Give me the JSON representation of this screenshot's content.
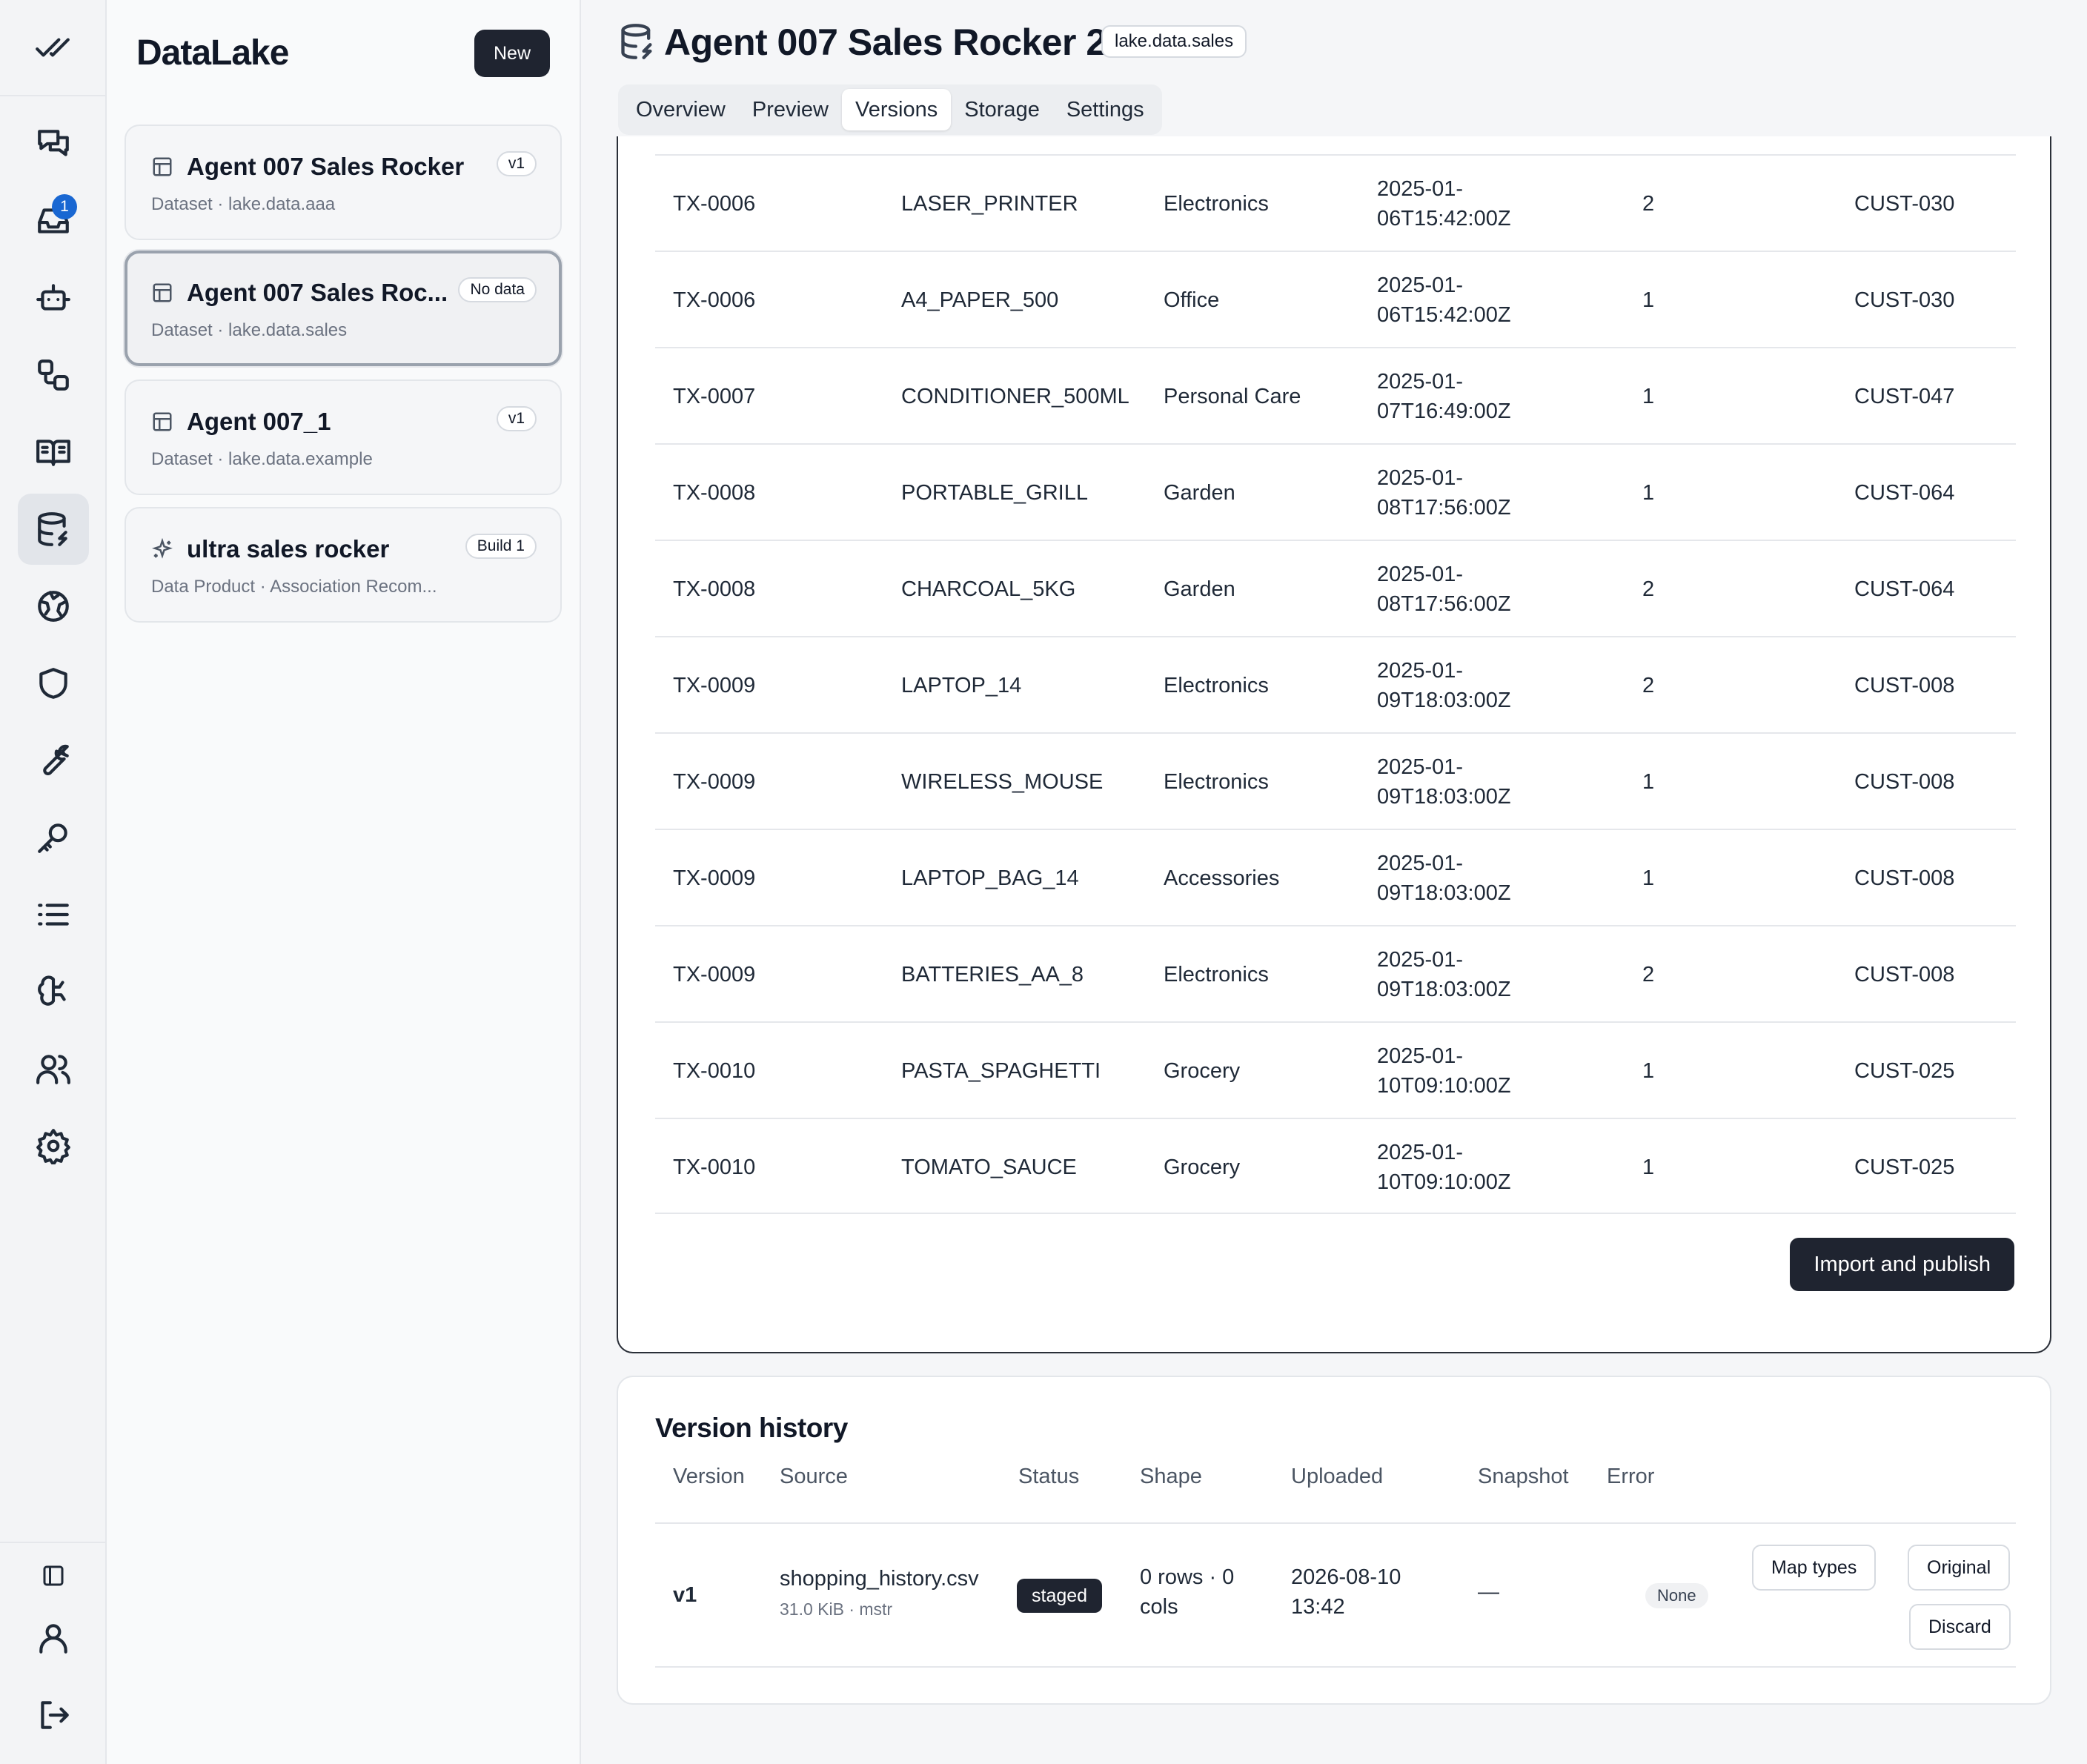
{
  "rail": {
    "top_icon": "double-check-icon",
    "items": [
      {
        "icon": "chat-icon"
      },
      {
        "icon": "inbox-icon",
        "badge": "1"
      },
      {
        "icon": "robot-icon"
      },
      {
        "icon": "workflow-icon"
      },
      {
        "icon": "book-icon"
      },
      {
        "icon": "database-icon",
        "active": true
      },
      {
        "icon": "globe-icon"
      },
      {
        "icon": "shield-icon"
      },
      {
        "icon": "wrench-icon"
      },
      {
        "icon": "key-icon"
      },
      {
        "icon": "list-icon"
      },
      {
        "icon": "brain-icon"
      },
      {
        "icon": "users-icon"
      },
      {
        "icon": "gear-icon"
      }
    ],
    "bottom": [
      {
        "icon": "sidebar-toggle-icon"
      },
      {
        "icon": "user-icon"
      },
      {
        "icon": "logout-icon"
      }
    ]
  },
  "panel": {
    "brand": "DataLake",
    "new_label": "New",
    "cards": [
      {
        "title": "Agent 007 Sales Rocker",
        "subtitle": "Dataset · lake.data.aaa",
        "badge": "v1",
        "icon": "table-icon"
      },
      {
        "title": "Agent 007 Sales Roc...",
        "subtitle": "Dataset · lake.data.sales",
        "badge": "No data",
        "icon": "table-icon",
        "selected": true
      },
      {
        "title": "Agent 007_1",
        "subtitle": "Dataset · lake.data.example",
        "badge": "v1",
        "icon": "table-icon"
      },
      {
        "title": "ultra sales rocker",
        "subtitle": "Data Product · Association Recom...",
        "badge": "Build 1",
        "icon": "sparkles-icon"
      }
    ]
  },
  "header": {
    "title": "Agent 007 Sales Rocker 2",
    "namespace": "lake.data.sales",
    "tabs": [
      "Overview",
      "Preview",
      "Versions",
      "Storage",
      "Settings"
    ],
    "active_tab": "Versions"
  },
  "preview": {
    "rows": [
      [
        "TX-0006",
        "LASER_PRINTER",
        "Electronics",
        "2025-01-06T15:42:00Z",
        "2",
        "CUST-030"
      ],
      [
        "TX-0006",
        "A4_PAPER_500",
        "Office",
        "2025-01-06T15:42:00Z",
        "1",
        "CUST-030"
      ],
      [
        "TX-0007",
        "CONDITIONER_500ML",
        "Personal Care",
        "2025-01-07T16:49:00Z",
        "1",
        "CUST-047"
      ],
      [
        "TX-0008",
        "PORTABLE_GRILL",
        "Garden",
        "2025-01-08T17:56:00Z",
        "1",
        "CUST-064"
      ],
      [
        "TX-0008",
        "CHARCOAL_5KG",
        "Garden",
        "2025-01-08T17:56:00Z",
        "2",
        "CUST-064"
      ],
      [
        "TX-0009",
        "LAPTOP_14",
        "Electronics",
        "2025-01-09T18:03:00Z",
        "2",
        "CUST-008"
      ],
      [
        "TX-0009",
        "WIRELESS_MOUSE",
        "Electronics",
        "2025-01-09T18:03:00Z",
        "1",
        "CUST-008"
      ],
      [
        "TX-0009",
        "LAPTOP_BAG_14",
        "Accessories",
        "2025-01-09T18:03:00Z",
        "1",
        "CUST-008"
      ],
      [
        "TX-0009",
        "BATTERIES_AA_8",
        "Electronics",
        "2025-01-09T18:03:00Z",
        "2",
        "CUST-008"
      ],
      [
        "TX-0010",
        "PASTA_SPAGHETTI",
        "Grocery",
        "2025-01-10T09:10:00Z",
        "1",
        "CUST-025"
      ],
      [
        "TX-0010",
        "TOMATO_SAUCE",
        "Grocery",
        "2025-01-10T09:10:00Z",
        "1",
        "CUST-025"
      ]
    ],
    "import_label": "Import and publish"
  },
  "version_history": {
    "title": "Version history",
    "headers": {
      "version": "Version",
      "source": "Source",
      "status": "Status",
      "shape": "Shape",
      "uploaded": "Uploaded",
      "snapshot": "Snapshot",
      "error": "Error"
    },
    "row": {
      "version": "v1",
      "source": "shopping_history.csv",
      "source_meta": "31.0 KiB · mstr",
      "status": "staged",
      "shape_line1": "0 rows · 0",
      "shape_line2": "cols",
      "uploaded_line1": "2026-08-10",
      "uploaded_line2": "13:42",
      "snapshot": "—",
      "error": "None"
    },
    "actions": {
      "map_types": "Map types",
      "original": "Original",
      "discard": "Discard"
    }
  }
}
